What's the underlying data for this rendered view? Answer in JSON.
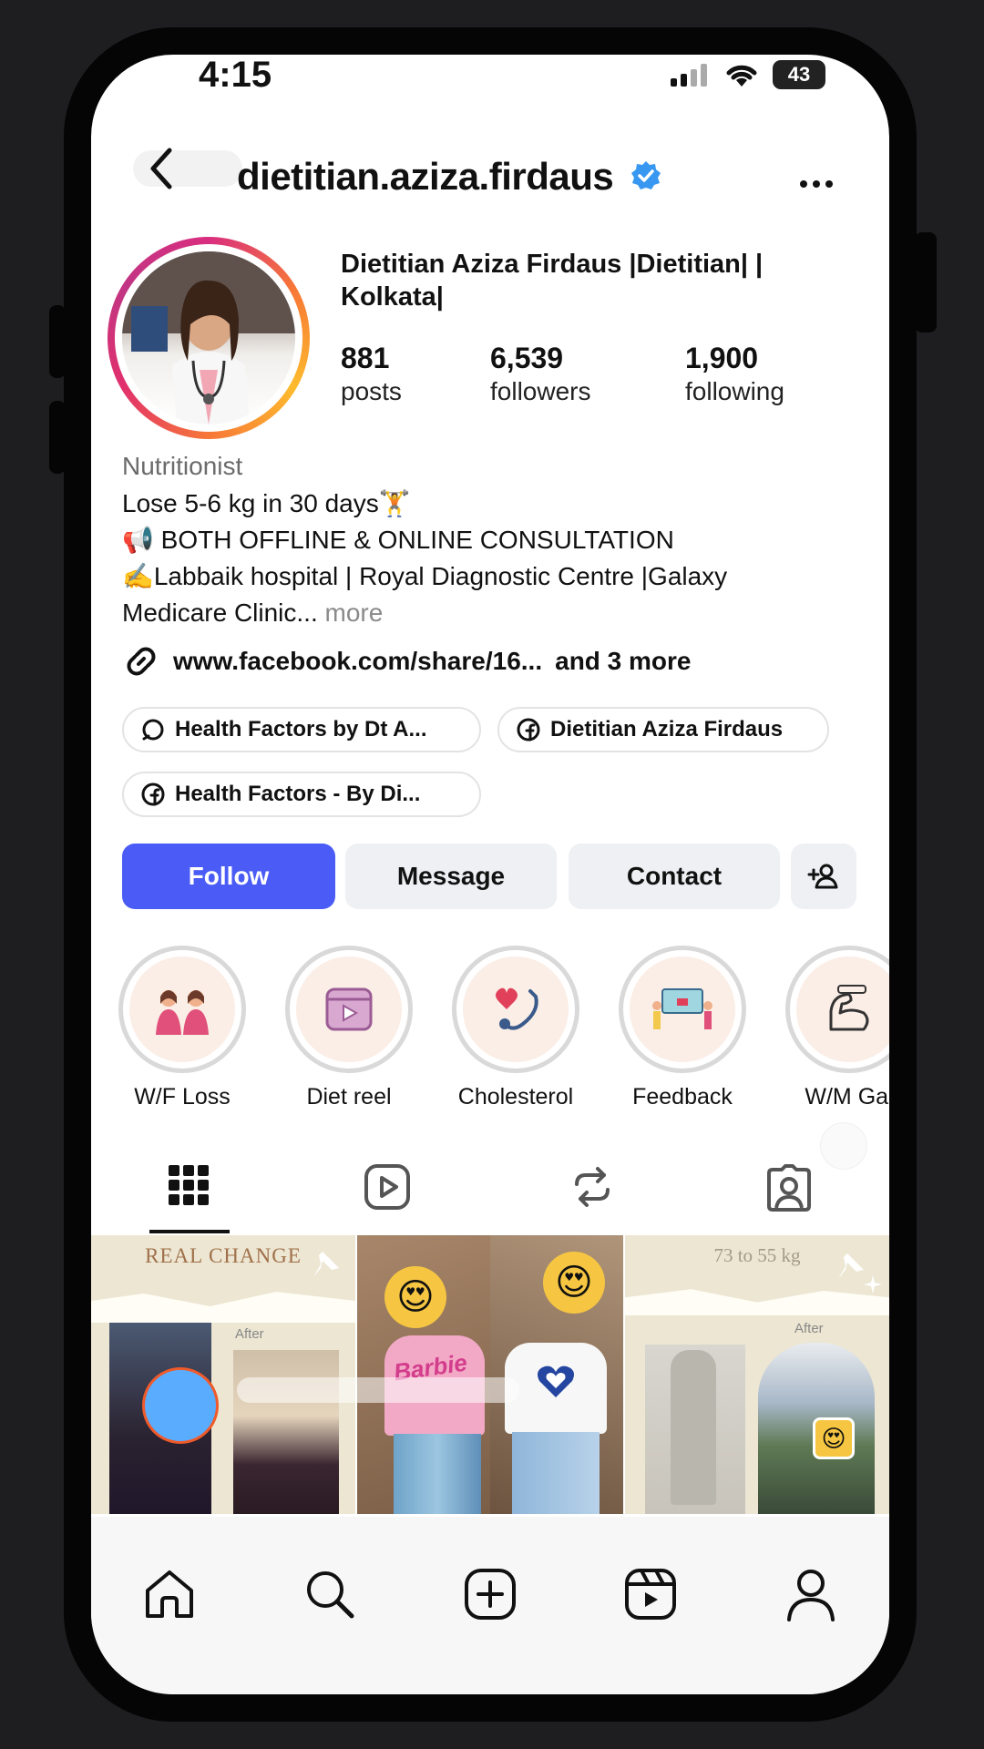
{
  "status_bar": {
    "time": "4:15",
    "battery": "43"
  },
  "header": {
    "username": "dietitian.aziza.firdaus",
    "verified": true,
    "back_icon": "chevron-left-icon",
    "more_icon": "more-dots-icon"
  },
  "profile": {
    "full_name": "Dietitian Aziza Firdaus |Dietitian| | Kolkata|",
    "stats": [
      {
        "value": "881",
        "label": "posts"
      },
      {
        "value": "6,539",
        "label": "followers"
      },
      {
        "value": "1,900",
        "label": "following"
      }
    ],
    "category": "Nutritionist",
    "bio": [
      "Lose 5-6 kg in 30 days🏋️",
      "📢 BOTH OFFLINE & ONLINE CONSULTATION",
      "✍️Labbaik hospital | Royal Diagnostic Centre |Galaxy",
      "Medicare Clinic..."
    ],
    "more_label": "more",
    "link": {
      "url": "www.facebook.com/share/16...",
      "extra": "and 3 more"
    },
    "chips": [
      {
        "label": "Health Factors by Dt A...",
        "icon": "threads-icon"
      },
      {
        "label": "Dietitian Aziza Firdaus",
        "icon": "facebook-icon"
      },
      {
        "label": "Health Factors - By Di...",
        "icon": "facebook-icon"
      }
    ]
  },
  "actions": {
    "follow": "Follow",
    "message": "Message",
    "contact": "Contact",
    "add_user_icon": "add-user-icon"
  },
  "highlights": [
    {
      "label": "W/F Loss",
      "icon": "two-women-icon"
    },
    {
      "label": "Diet reel",
      "icon": "video-play-icon"
    },
    {
      "label": "Cholesterol",
      "icon": "stethoscope-heart-icon"
    },
    {
      "label": "Feedback",
      "icon": "feedback-board-icon"
    },
    {
      "label": "W/M Gai",
      "icon": "flex-arm-icon"
    }
  ],
  "tabs": [
    {
      "name": "grid",
      "icon": "grid-icon",
      "active": true
    },
    {
      "name": "reels",
      "icon": "reels-icon",
      "active": false
    },
    {
      "name": "reposts",
      "icon": "repost-icon",
      "active": false
    },
    {
      "name": "tagged",
      "icon": "tagged-icon",
      "active": false
    }
  ],
  "posts": [
    {
      "caption": "REAL CHANGE",
      "sub": "After"
    },
    {
      "caption": "Barbie",
      "sub": ""
    },
    {
      "caption": "73 to 55 kg",
      "sub": "After"
    }
  ],
  "bottom_nav": [
    {
      "name": "home",
      "icon": "home-icon"
    },
    {
      "name": "search",
      "icon": "search-icon"
    },
    {
      "name": "create",
      "icon": "plus-square-icon"
    },
    {
      "name": "reels",
      "icon": "reels-icon"
    },
    {
      "name": "profile",
      "icon": "profile-icon"
    }
  ],
  "colors": {
    "accent": "#4a5cf5",
    "verified": "#3897f0",
    "chip_border": "#e3e3e3",
    "button_gray": "#eef0f3"
  }
}
